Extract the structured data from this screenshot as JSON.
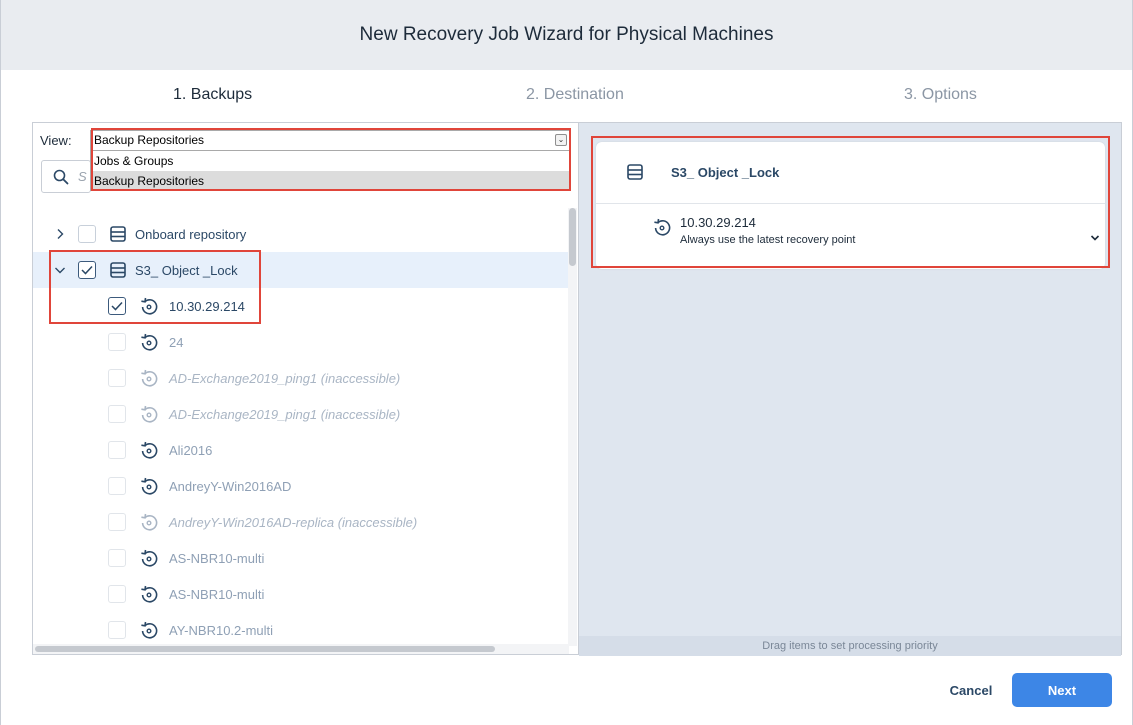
{
  "window": {
    "title": "New Recovery Job Wizard for Physical Machines"
  },
  "steps": [
    {
      "label": "1. Backups",
      "state": "active"
    },
    {
      "label": "2. Destination",
      "state": "inactive"
    },
    {
      "label": "3. Options",
      "state": "inactive"
    }
  ],
  "left_panel": {
    "view_label": "View:",
    "view_selected": "Backup Repositories",
    "view_options": [
      "Jobs & Groups",
      "Backup Repositories"
    ],
    "search_placeholder": "S",
    "tree": [
      {
        "label": "Onboard repository",
        "type": "repository",
        "expanded": false,
        "checked": false,
        "state": "normal"
      },
      {
        "label": "S3_ Object _Lock",
        "type": "repository",
        "expanded": true,
        "checked": true,
        "state": "normal"
      },
      {
        "label": "10.30.29.214",
        "type": "backup",
        "checked": true,
        "state": "normal"
      },
      {
        "label": "24",
        "type": "backup",
        "checked": false,
        "state": "muted"
      },
      {
        "label": "AD-Exchange2019_ping1 (inaccessible)",
        "type": "backup",
        "checked": false,
        "state": "inaccessible"
      },
      {
        "label": "AD-Exchange2019_ping1 (inaccessible)",
        "type": "backup",
        "checked": false,
        "state": "inaccessible"
      },
      {
        "label": "Ali2016",
        "type": "backup",
        "checked": false,
        "state": "muted"
      },
      {
        "label": "AndreyY-Win2016AD",
        "type": "backup",
        "checked": false,
        "state": "muted"
      },
      {
        "label": "AndreyY-Win2016AD-replica (inaccessible)",
        "type": "backup",
        "checked": false,
        "state": "inaccessible"
      },
      {
        "label": "AS-NBR10-multi",
        "type": "backup",
        "checked": false,
        "state": "muted"
      },
      {
        "label": "AS-NBR10-multi",
        "type": "backup",
        "checked": false,
        "state": "muted"
      },
      {
        "label": "AY-NBR10.2-multi",
        "type": "backup",
        "checked": false,
        "state": "muted"
      }
    ]
  },
  "right_panel": {
    "card": {
      "title": "S3_ Object _Lock",
      "item_name": "10.30.29.214",
      "item_detail": "Always use the latest recovery point"
    },
    "drag_hint": "Drag items to set processing priority"
  },
  "footer": {
    "cancel_label": "Cancel",
    "next_label": "Next"
  },
  "colors": {
    "accent": "#3d86e6",
    "highlight": "#e0453a",
    "selected_row": "#e7f0fb"
  },
  "icons": [
    "search-icon",
    "repository-icon",
    "backup-restore-icon",
    "chevron-right-icon",
    "chevron-down-icon",
    "checkmark-icon"
  ]
}
